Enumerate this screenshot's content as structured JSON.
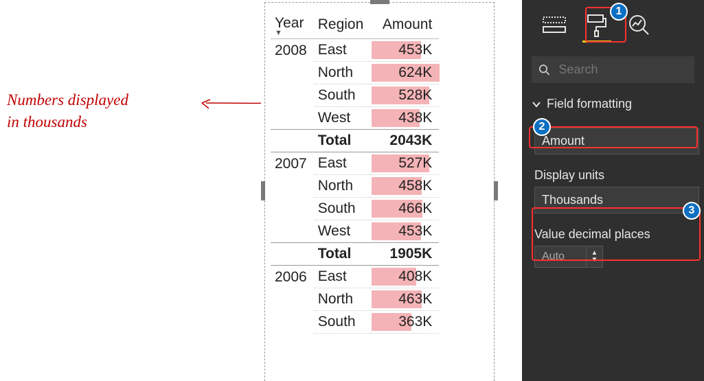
{
  "annotation": {
    "line1": "Numbers displayed",
    "line2": "in thousands"
  },
  "table": {
    "headers": {
      "year": "Year",
      "region": "Region",
      "amount": "Amount"
    },
    "groups": [
      {
        "year": "2008",
        "rows": [
          {
            "region": "East",
            "amount": "453K",
            "barPct": 72
          },
          {
            "region": "North",
            "amount": "624K",
            "barPct": 99
          },
          {
            "region": "South",
            "amount": "528K",
            "barPct": 84
          },
          {
            "region": "West",
            "amount": "438K",
            "barPct": 70
          }
        ],
        "totalLabel": "Total",
        "total": "2043K"
      },
      {
        "year": "2007",
        "rows": [
          {
            "region": "East",
            "amount": "527K",
            "barPct": 84
          },
          {
            "region": "North",
            "amount": "458K",
            "barPct": 73
          },
          {
            "region": "South",
            "amount": "466K",
            "barPct": 74
          },
          {
            "region": "West",
            "amount": "453K",
            "barPct": 72
          }
        ],
        "totalLabel": "Total",
        "total": "1905K"
      },
      {
        "year": "2006",
        "rows": [
          {
            "region": "East",
            "amount": "408K",
            "barPct": 65
          },
          {
            "region": "North",
            "amount": "463K",
            "barPct": 73
          },
          {
            "region": "South",
            "amount": "363K",
            "barPct": 58
          }
        ]
      }
    ]
  },
  "pane": {
    "searchPlaceholder": "Search",
    "section": "Field formatting",
    "fieldName": "Amount",
    "displayUnitsLabel": "Display units",
    "displayUnitsValue": "Thousands",
    "decimalLabel": "Value decimal places",
    "decimalValue": "Auto"
  },
  "badges": {
    "b1": "1",
    "b2": "2",
    "b3": "3"
  }
}
